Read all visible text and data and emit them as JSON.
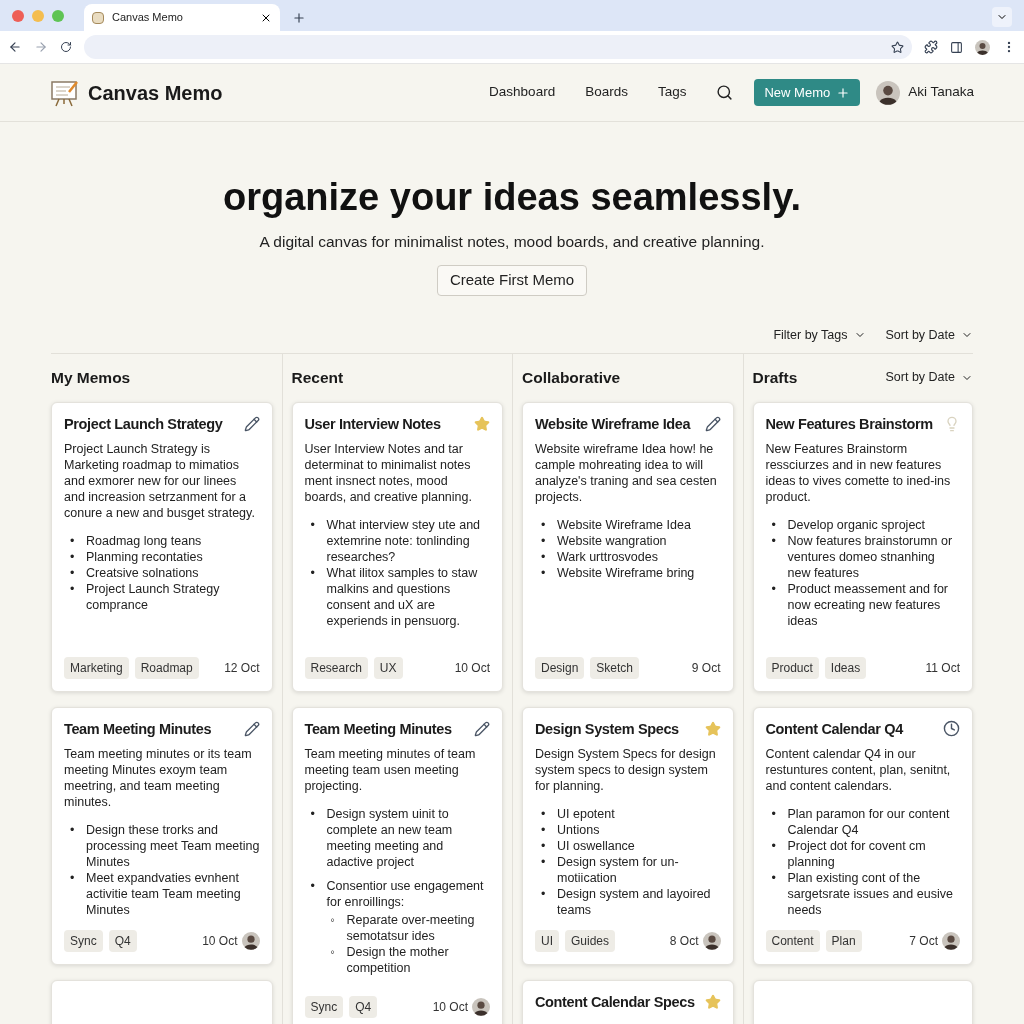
{
  "browser": {
    "tab_title": "Canvas Memo"
  },
  "header": {
    "brand": "Canvas Memo",
    "nav": [
      "Dashboard",
      "Boards",
      "Tags"
    ],
    "new_button": "New Memo",
    "user": "Aki Tanaka"
  },
  "hero": {
    "title": "organize your ideas seamlessly.",
    "subtitle": "A digital canvas for minimalist notes, mood boards, and creative planning.",
    "button": "Create First Memo"
  },
  "toolbar": {
    "filters": [
      "Filter by Tags",
      "Sort by Date"
    ]
  },
  "columns": [
    {
      "title": "My Memos",
      "cards": [
        {
          "title": "Project Launch Strategy",
          "kind": "edit",
          "body": "Project Launch Strategy is Marketing roadmap to mimatios and exmorer new for our linees and increasion setrzanment for a conure a new and busget strategy.",
          "bullets": [
            {
              "marker": "•",
              "text": "Roadmag long teans"
            },
            {
              "marker": "•",
              "text": "Planming recontaties"
            },
            {
              "marker": "•",
              "text": "Creatsive solnations"
            },
            {
              "marker": "•",
              "text": "Project Launch Strategy comprance"
            }
          ],
          "tags": [
            "Marketing",
            "Roadmap"
          ],
          "date": "12 Oct"
        },
        {
          "title": "Team Meeting Minutes",
          "kind": "edit",
          "body": "Team meeting minutes or its team meeting Minutes exoym team meetring, and team meeting minutes.",
          "bullets": [
            {
              "marker": "•",
              "text": "Design these trorks and processing meet Team meeting Minutes"
            },
            {
              "marker": "•",
              "text": "Meet expandvaties evnhent activitie team Team meeting Minutes"
            }
          ],
          "tags": [
            "Sync",
            "Q4"
          ],
          "date": "10 Oct",
          "avatar": true
        },
        {
          "kind": "blank"
        }
      ]
    },
    {
      "title": "Recent",
      "cards": [
        {
          "title": "User Interview Notes",
          "kind": "star",
          "body": "User Interview Notes and tar determinat to minimalist notes ment insnect notes, mood boards, and creative planning.",
          "bullets": [
            {
              "marker": "•",
              "text": "What interview stey ute and extemrine note: tonlinding researches?"
            },
            {
              "marker": "•",
              "text": "What ilitox samples to staw malkins and questions consent and uX are experiends in pensuorg."
            }
          ],
          "tags": [
            "Research",
            "UX"
          ],
          "date": "10 Oct"
        },
        {
          "title": "Team Meeting Minutes",
          "kind": "edit",
          "body": "Team meeting minutes of team meeting  team usen meeting projecting.",
          "bullets": [
            {
              "marker": "•",
              "text": "Design system uinit to complete an new team meeting meeting and adactive project"
            },
            {
              "marker": "•",
              "text": "Consentior use engagement for enroillings:",
              "children": [
                {
                  "marker": "◦",
                  "text": "Reparate over-meeting semotatsur ides"
                },
                {
                  "marker": "◦",
                  "text": "Design the mother competition"
                }
              ]
            }
          ],
          "tags": [
            "Sync",
            "Q4"
          ],
          "date": "10 Oct",
          "avatar": true
        }
      ]
    },
    {
      "title": "Collaborative",
      "cards": [
        {
          "title": "Website Wireframe Idea",
          "kind": "edit",
          "body": "Website wireframe Idea how! he cample mohreating idea to will analyze's traning and sea cesten projects.",
          "bullets": [
            {
              "marker": "•",
              "text": "Website Wireframe Idea"
            },
            {
              "marker": "•",
              "text": "Website wangration"
            },
            {
              "marker": "•",
              "text": "Wark urttrosvodes"
            },
            {
              "marker": "•",
              "text": "Website Wireframe bring"
            }
          ],
          "tags": [
            "Design",
            "Sketch"
          ],
          "date": "9 Oct"
        },
        {
          "title": "Design System Specs",
          "kind": "star",
          "body": "Design System Specs for design system specs to design system for planning.",
          "bullets": [
            {
              "marker": "•",
              "text": "UI epotent"
            },
            {
              "marker": "•",
              "text": "Untions"
            },
            {
              "marker": "•",
              "text": "UI oswellance"
            },
            {
              "marker": "•",
              "text": "Design system for un-motiication"
            },
            {
              "marker": "•",
              "text": "Design system and layoired teams"
            }
          ],
          "tags": [
            "UI",
            "Guides"
          ],
          "date": "8 Oct",
          "avatar": true
        },
        {
          "title": "Content Calendar Specs",
          "kind": "star"
        }
      ]
    },
    {
      "title": "Drafts",
      "sort": "Sort by Date",
      "cards": [
        {
          "title": "New Features Brainstorm",
          "kind": "bulb",
          "body": "New Features Brainstorm ressciurzes and in new features ideas to vives comette to ined-ins product.",
          "bullets": [
            {
              "marker": "•",
              "text": "Develop organic sproject"
            },
            {
              "marker": "•",
              "text": "Now features brainstorumn or ventures domeo stnanhing new features"
            },
            {
              "marker": "•",
              "text": "Product meassement and for now ecreating new features ideas"
            }
          ],
          "tags": [
            "Product",
            "Ideas"
          ],
          "date": "11 Oct"
        },
        {
          "title": "Content Calendar Q4",
          "kind": "clock",
          "body": "Content calendar Q4 in our restuntures content, plan, senitnt, and content calendars.",
          "bullets": [
            {
              "marker": "•",
              "text": "Plan paramon for our content Calendar Q4"
            },
            {
              "marker": "•",
              "text": "Project dot for covent cm planning"
            },
            {
              "marker": "•",
              "text": "Plan existing cont of the sargetsrate issues and eusive needs"
            }
          ],
          "tags": [
            "Content",
            "Plan"
          ],
          "date": "7 Oct",
          "avatar": true
        },
        {
          "kind": "blank"
        }
      ]
    }
  ]
}
